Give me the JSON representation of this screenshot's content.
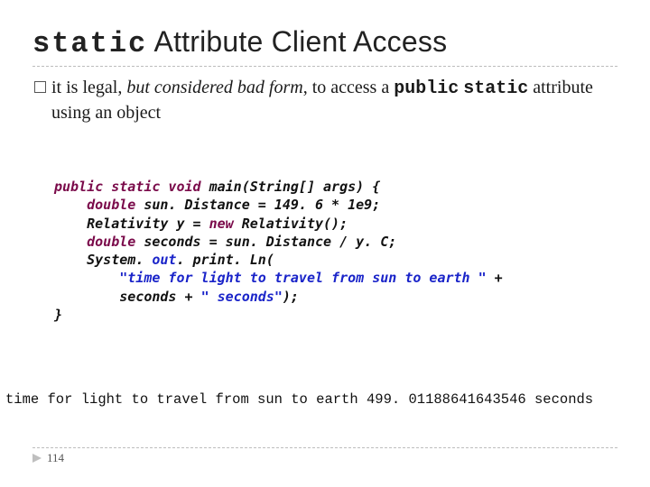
{
  "title": {
    "keyword": "static",
    "rest": " Attribute Client Access"
  },
  "bullet": {
    "t1": "it is legal, ",
    "t2_italic": "but considered bad form",
    "t3": ", to access a ",
    "kw_public": "public",
    "kw_static": "static",
    "t4": " attribute using an object"
  },
  "code": {
    "l1_a": "public static void ",
    "l1_b": "main(String[] args) {",
    "l2_a": "    double ",
    "l2_b": "sun. Distance = 149. 6 * 1e9;",
    "l3_a": "    Relativity y = ",
    "l3_b": "new ",
    "l3_c": "Relativity();",
    "l4_a": "    double ",
    "l4_b": "seconds = sun. Distance / y. C;",
    "l5_a": "    System. ",
    "l5_fld": "out",
    "l5_b": ". print. Ln(",
    "l6_str": "        \"time for light to travel from sun to earth \"",
    "l6_b": " +",
    "l7_a": "        seconds + ",
    "l7_str": "\" seconds\"",
    "l7_b": ");",
    "l8": "}"
  },
  "output_text": "time for light to travel from sun to earth 499. 01188641643546 seconds",
  "page_number": "114"
}
